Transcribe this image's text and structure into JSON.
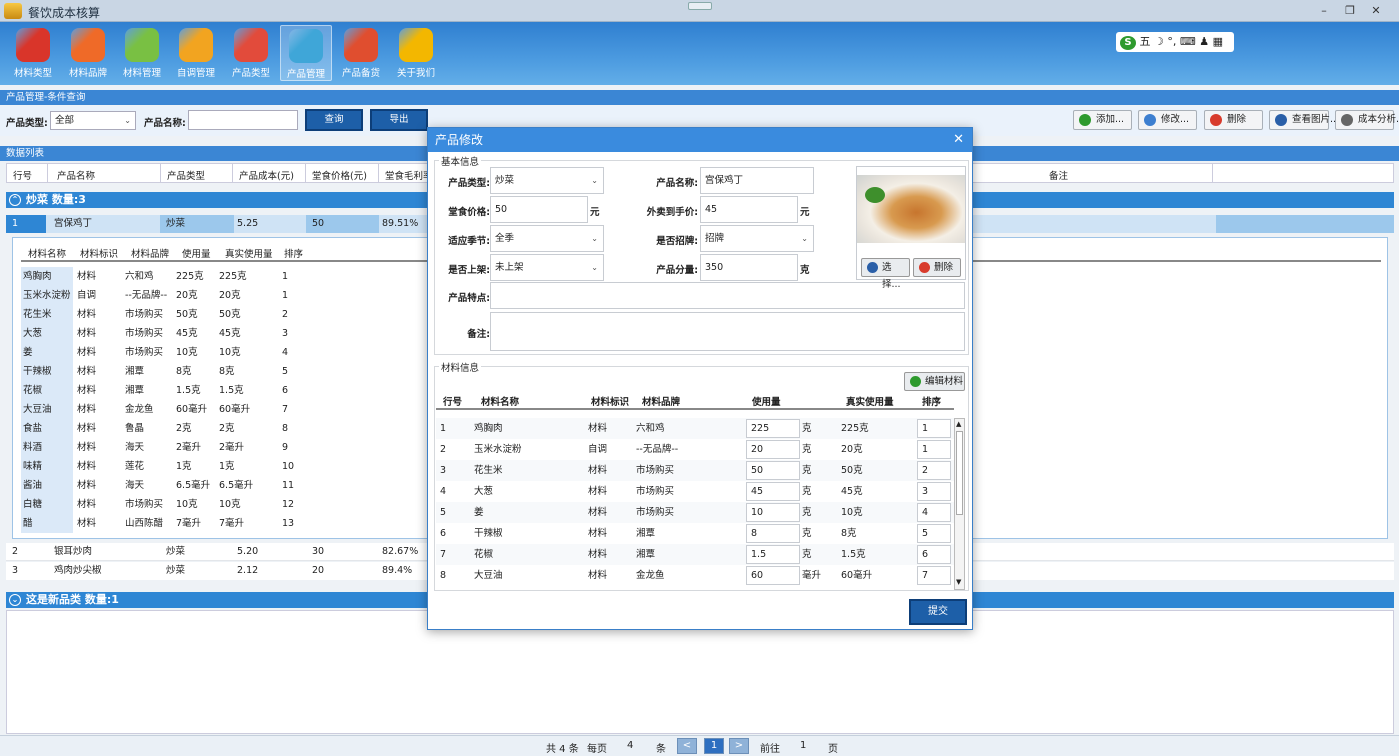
{
  "window": {
    "title": "餐饮成本核算"
  },
  "ribbon": {
    "items": [
      {
        "label": "材料类型",
        "icon": "material-type-icon",
        "color": "#d9352a"
      },
      {
        "label": "材料品牌",
        "icon": "material-brand-icon",
        "color": "#ef6a28"
      },
      {
        "label": "材料管理",
        "icon": "material-manage-icon",
        "color": "#79c043"
      },
      {
        "label": "自调管理",
        "icon": "self-adjust-icon",
        "color": "#f2a420"
      },
      {
        "label": "产品类型",
        "icon": "product-type-icon",
        "color": "#e24b3b"
      },
      {
        "label": "产品管理",
        "icon": "product-manage-icon",
        "color": "#3fa6d8"
      },
      {
        "label": "产品备货",
        "icon": "product-stock-icon",
        "color": "#e04e2f"
      },
      {
        "label": "关于我们",
        "icon": "about-icon",
        "color": "#f3b700"
      }
    ],
    "active": "产品管理"
  },
  "ime": {
    "text": "五"
  },
  "query": {
    "section_title": "产品管理-条件查询",
    "type_label": "产品类型:",
    "type_value": "全部",
    "name_label": "产品名称:",
    "name_value": "",
    "search_label": "查询",
    "export_label": "导出",
    "actions": [
      {
        "label": "添加...",
        "color": "#2e9a2e"
      },
      {
        "label": "修改...",
        "color": "#3d7fd0"
      },
      {
        "label": "删除",
        "color": "#d83b2c"
      },
      {
        "label": "查看图片...",
        "color": "#2a5fa8"
      },
      {
        "label": "成本分析...",
        "color": "#666"
      }
    ]
  },
  "list": {
    "section_title": "数据列表",
    "headers": [
      "行号",
      "产品名称",
      "产品类型",
      "产品成本(元)",
      "堂食价格(元)",
      "堂食毛利率",
      "备注"
    ]
  },
  "groups": [
    {
      "label": "炒菜 数量:3"
    },
    {
      "label": "这是新品类 数量:1"
    }
  ],
  "products": [
    {
      "no": "1",
      "name": "宫保鸡丁",
      "type": "炒菜",
      "cost": "5.25",
      "price": "50",
      "margin": "89.51%"
    },
    {
      "no": "2",
      "name": "银耳炒肉",
      "type": "炒菜",
      "cost": "5.20",
      "price": "30",
      "margin": "82.67%"
    },
    {
      "no": "3",
      "name": "鸡肉炒尖椒",
      "type": "炒菜",
      "cost": "2.12",
      "price": "20",
      "margin": "89.4%"
    }
  ],
  "detail": {
    "headers": [
      "材料名称",
      "材料标识",
      "材料品牌",
      "使用量",
      "真实使用量",
      "排序"
    ],
    "rows": [
      {
        "name": "鸡胸肉",
        "tag": "材料",
        "brand": "六和鸡",
        "use": "225克",
        "real": "225克",
        "order": "1"
      },
      {
        "name": "玉米水淀粉",
        "tag": "自调",
        "brand": "--无品牌--",
        "use": "20克",
        "real": "20克",
        "order": "1"
      },
      {
        "name": "花生米",
        "tag": "材料",
        "brand": "市场购买",
        "use": "50克",
        "real": "50克",
        "order": "2"
      },
      {
        "name": "大葱",
        "tag": "材料",
        "brand": "市场购买",
        "use": "45克",
        "real": "45克",
        "order": "3"
      },
      {
        "name": "姜",
        "tag": "材料",
        "brand": "市场购买",
        "use": "10克",
        "real": "10克",
        "order": "4"
      },
      {
        "name": "干辣椒",
        "tag": "材料",
        "brand": "湘覃",
        "use": "8克",
        "real": "8克",
        "order": "5"
      },
      {
        "name": "花椒",
        "tag": "材料",
        "brand": "湘覃",
        "use": "1.5克",
        "real": "1.5克",
        "order": "6"
      },
      {
        "name": "大豆油",
        "tag": "材料",
        "brand": "金龙鱼",
        "use": "60毫升",
        "real": "60毫升",
        "order": "7"
      },
      {
        "name": "食盐",
        "tag": "材料",
        "brand": "鲁晶",
        "use": "2克",
        "real": "2克",
        "order": "8"
      },
      {
        "name": "料酒",
        "tag": "材料",
        "brand": "海天",
        "use": "2毫升",
        "real": "2毫升",
        "order": "9"
      },
      {
        "name": "味精",
        "tag": "材料",
        "brand": "莲花",
        "use": "1克",
        "real": "1克",
        "order": "10"
      },
      {
        "name": "酱油",
        "tag": "材料",
        "brand": "海天",
        "use": "6.5毫升",
        "real": "6.5毫升",
        "order": "11"
      },
      {
        "name": "白糖",
        "tag": "材料",
        "brand": "市场购买",
        "use": "10克",
        "real": "10克",
        "order": "12"
      },
      {
        "name": "醋",
        "tag": "材料",
        "brand": "山西陈醋",
        "use": "7毫升",
        "real": "7毫升",
        "order": "13"
      }
    ]
  },
  "pager": {
    "total": "共 4 条",
    "per_label": "每页",
    "per_value": "4",
    "per_unit": "条",
    "prev": "<",
    "current": "1",
    "next": ">",
    "goto_label": "前往",
    "goto_value": "1",
    "goto_unit": "页"
  },
  "modal": {
    "title": "产品修改",
    "basic_legend": "基本信息",
    "fields": {
      "type_label": "产品类型:",
      "type_value": "炒菜",
      "name_label": "产品名称:",
      "name_value": "宫保鸡丁",
      "price_label": "堂食价格:",
      "price_value": "50",
      "price_unit": "元",
      "takeout_label": "外卖到手价:",
      "takeout_value": "45",
      "takeout_unit": "元",
      "season_label": "适应季节:",
      "season_value": "全季",
      "sign_label": "是否招牌:",
      "sign_value": "招牌",
      "shelf_label": "是否上架:",
      "shelf_value": "未上架",
      "portion_label": "产品分量:",
      "portion_value": "350",
      "portion_unit": "克",
      "feature_label": "产品特点:",
      "feature_value": "",
      "note_label": "备注:",
      "note_value": ""
    },
    "image_buttons": {
      "select": "选择...",
      "delete": "删除"
    },
    "material_legend": "材料信息",
    "edit_materials": "编辑材料",
    "headers": [
      "行号",
      "材料名称",
      "材料标识",
      "材料品牌",
      "使用量",
      "真实使用量",
      "排序"
    ],
    "rows": [
      {
        "no": "1",
        "name": "鸡胸肉",
        "tag": "材料",
        "brand": "六和鸡",
        "use": "225",
        "unit": "克",
        "real": "225克",
        "order": "1"
      },
      {
        "no": "2",
        "name": "玉米水淀粉",
        "tag": "自调",
        "brand": "--无品牌--",
        "use": "20",
        "unit": "克",
        "real": "20克",
        "order": "1"
      },
      {
        "no": "3",
        "name": "花生米",
        "tag": "材料",
        "brand": "市场购买",
        "use": "50",
        "unit": "克",
        "real": "50克",
        "order": "2"
      },
      {
        "no": "4",
        "name": "大葱",
        "tag": "材料",
        "brand": "市场购买",
        "use": "45",
        "unit": "克",
        "real": "45克",
        "order": "3"
      },
      {
        "no": "5",
        "name": "姜",
        "tag": "材料",
        "brand": "市场购买",
        "use": "10",
        "unit": "克",
        "real": "10克",
        "order": "4"
      },
      {
        "no": "6",
        "name": "干辣椒",
        "tag": "材料",
        "brand": "湘覃",
        "use": "8",
        "unit": "克",
        "real": "8克",
        "order": "5"
      },
      {
        "no": "7",
        "name": "花椒",
        "tag": "材料",
        "brand": "湘覃",
        "use": "1.5",
        "unit": "克",
        "real": "1.5克",
        "order": "6"
      },
      {
        "no": "8",
        "name": "大豆油",
        "tag": "材料",
        "brand": "金龙鱼",
        "use": "60",
        "unit": "毫升",
        "real": "60毫升",
        "order": "7"
      }
    ],
    "submit": "提交"
  }
}
